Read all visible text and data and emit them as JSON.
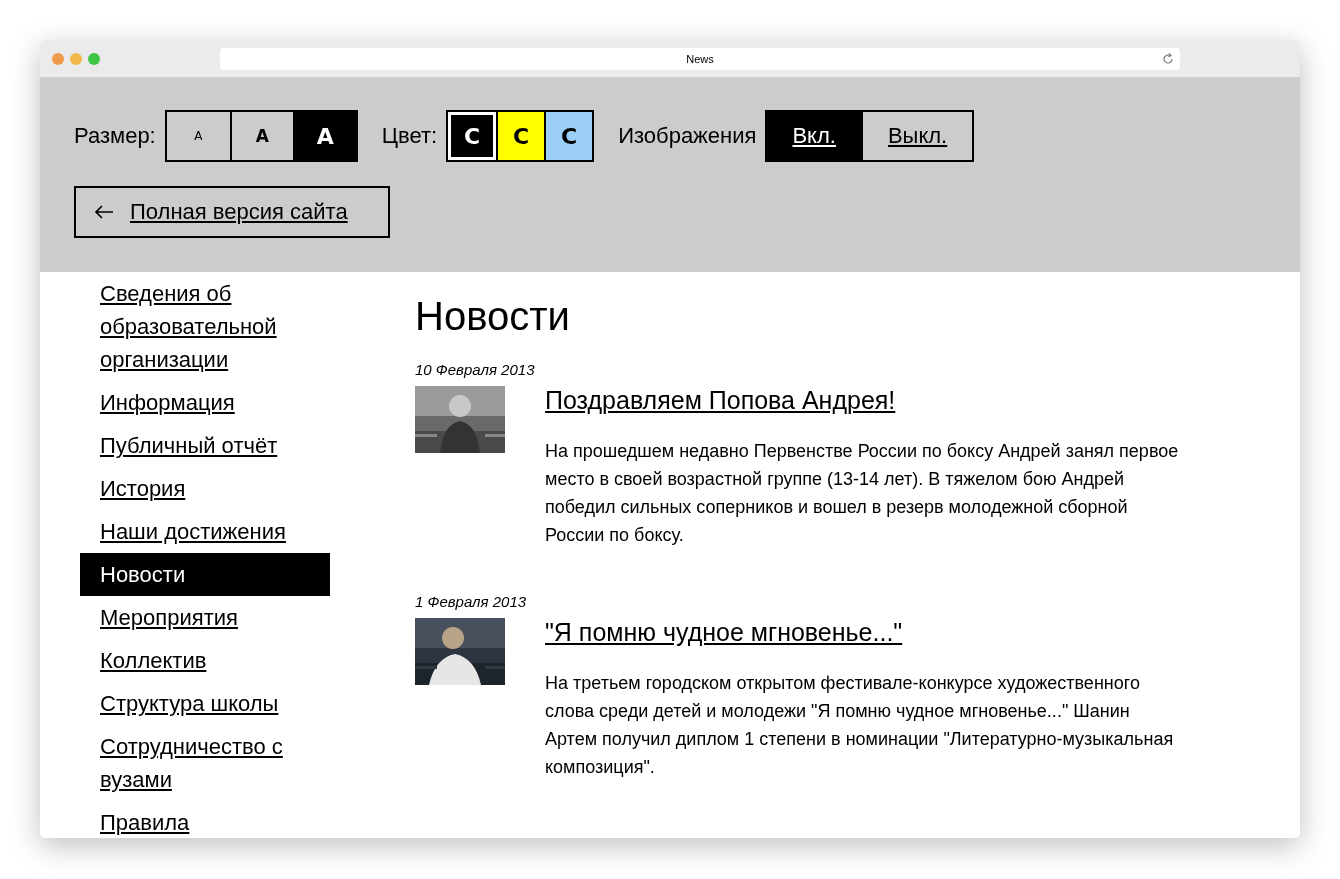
{
  "window": {
    "title": "News"
  },
  "toolbar": {
    "size_label": "Размер:",
    "sizes": [
      {
        "label": "A",
        "selected": false
      },
      {
        "label": "A",
        "selected": false
      },
      {
        "label": "A",
        "selected": true
      }
    ],
    "color_label": "Цвет:",
    "colors": [
      {
        "label": "C",
        "color": "#000000",
        "selected": true
      },
      {
        "label": "C",
        "color": "#ffff00",
        "selected": false
      },
      {
        "label": "C",
        "color": "#9ccff5",
        "selected": false
      }
    ],
    "images_label": "Изображения",
    "images": [
      {
        "label": "Вкл.",
        "selected": true
      },
      {
        "label": "Выкл.",
        "selected": false
      }
    ],
    "full_version": "Полная версия сайта"
  },
  "sidebar": {
    "items": [
      {
        "label": "Сведения об образовательной организации",
        "selected": false
      },
      {
        "label": "Информация",
        "selected": false
      },
      {
        "label": "Публичный отчёт",
        "selected": false
      },
      {
        "label": "История",
        "selected": false
      },
      {
        "label": "Наши достижения",
        "selected": false
      },
      {
        "label": "Новости",
        "selected": true
      },
      {
        "label": "Мероприятия",
        "selected": false
      },
      {
        "label": "Коллектив",
        "selected": false
      },
      {
        "label": "Структура школы",
        "selected": false
      },
      {
        "label": "Сотрудничество с вузами",
        "selected": false
      },
      {
        "label": "Правила",
        "selected": false
      }
    ]
  },
  "page_title": "Новости",
  "news": [
    {
      "date": "10 Февраля 2013",
      "title": "Поздравляем Попова Андрея!",
      "text": "На прошедшем недавно Первенстве России по боксу Андрей занял первое место в своей возрастной группе (13-14 лет). В тяжелом бою Андрей победил сильных соперников и вошел в резерв молодежной сборной России по боксу."
    },
    {
      "date": "1 Февраля 2013",
      "title": "\"Я помню чудное мгновенье...\"",
      "text": "На третьем городском открытом фестивале-конкурсе художественного слова среди детей и молодежи \"Я помню чудное мгновенье...\" Шанин Артем получил диплом 1 степени в номинации \"Литературно-музыкальная композиция\"."
    }
  ]
}
